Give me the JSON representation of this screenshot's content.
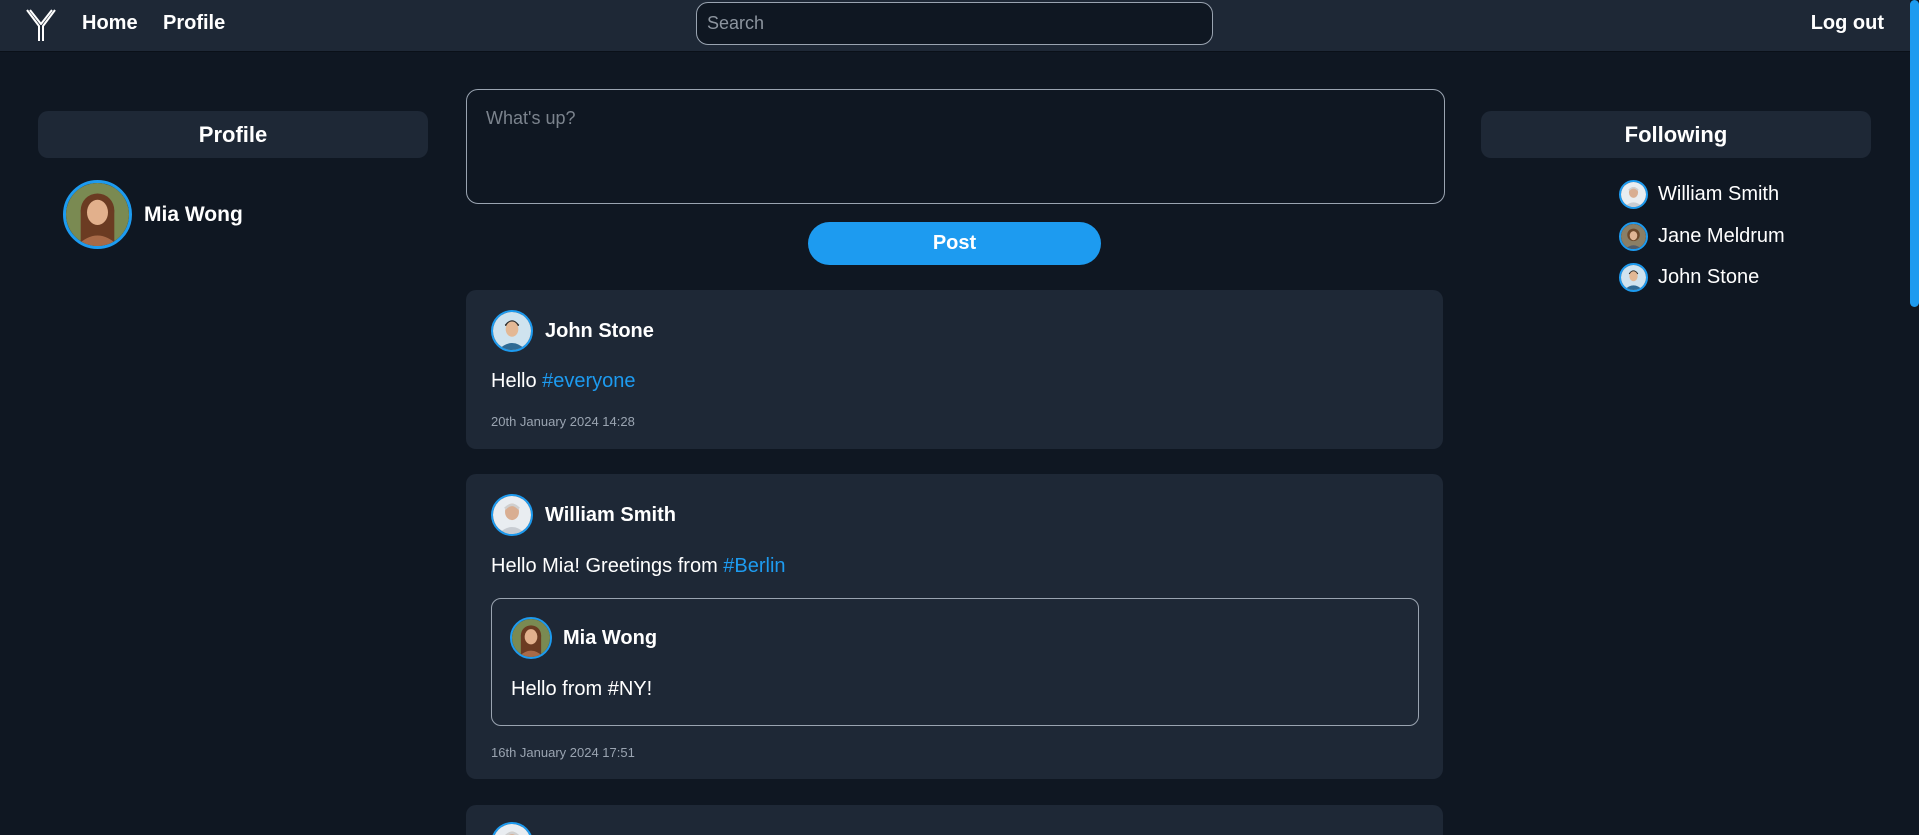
{
  "nav": {
    "logo_icon": "y-logo-icon",
    "home": "Home",
    "profile": "Profile",
    "search_placeholder": "Search",
    "logout": "Log out"
  },
  "left_panel": {
    "title": "Profile",
    "user": {
      "name": "Mia Wong",
      "avatar_icon": "user-avatar"
    }
  },
  "right_panel": {
    "title": "Following",
    "items": [
      {
        "name": "William Smith"
      },
      {
        "name": "Jane Meldrum"
      },
      {
        "name": "John Stone"
      }
    ]
  },
  "compose": {
    "placeholder": "What's up?",
    "post_label": "Post"
  },
  "feed": [
    {
      "author": "John Stone",
      "text": "Hello ",
      "hashtag": "#everyone",
      "time": "20th January 2024 14:28"
    },
    {
      "author": "William Smith",
      "text": "Hello Mia! Greetings from ",
      "hashtag": "#Berlin",
      "time": "16th January 2024 17:51",
      "quote": {
        "author": "Mia Wong",
        "text": "Hello from #NY!"
      }
    }
  ],
  "colors": {
    "background": "#0f1722",
    "surface": "#1e2836",
    "accent": "#1d9bf0",
    "muted_text": "#9aa4b1"
  }
}
